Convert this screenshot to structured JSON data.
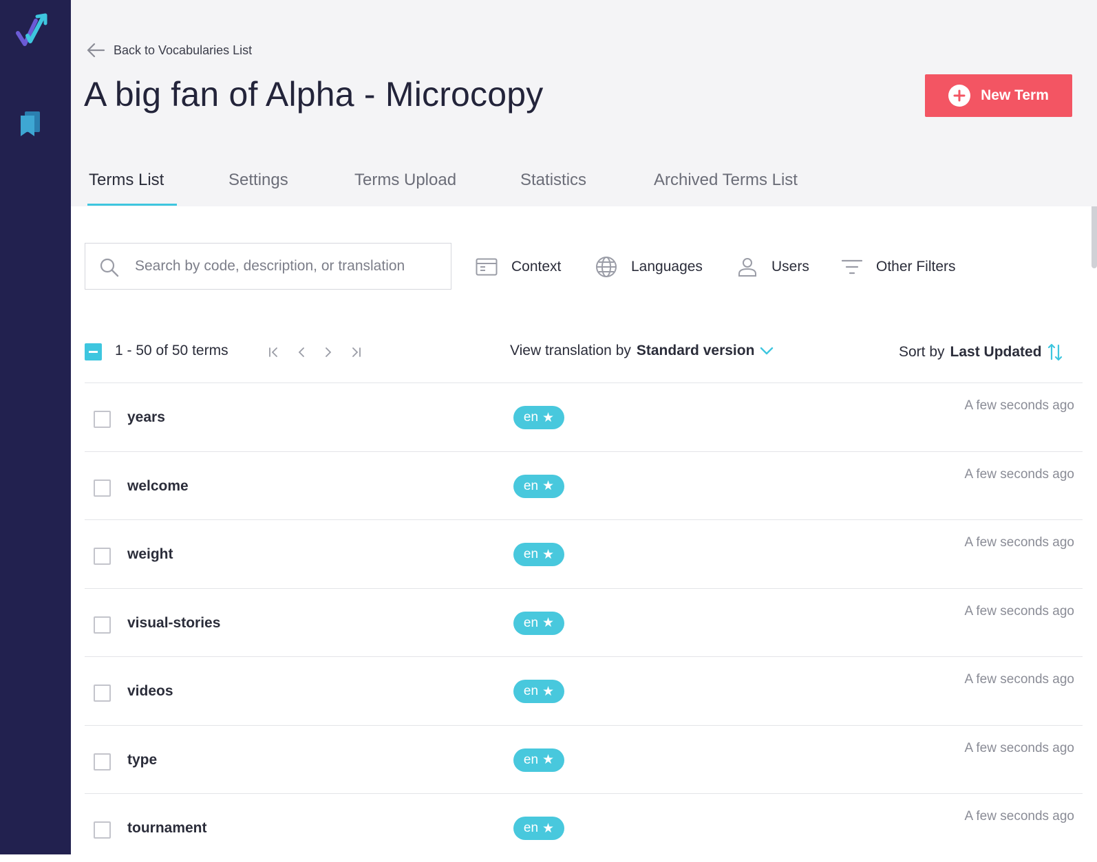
{
  "app": {
    "accent": "#3ec6df",
    "sidebar_bg": "#22214f",
    "primary_btn": "#f35563"
  },
  "sidebar": {
    "logo_icon": "checkmark-arrow-logo",
    "items": [
      {
        "icon": "bookmark-icon",
        "name": "vocabularies"
      }
    ]
  },
  "header": {
    "back_label": "Back to Vocabularies List",
    "title": "A big fan of Alpha - Microcopy",
    "new_term_label": "New Term"
  },
  "tabs": [
    {
      "label": "Terms List",
      "active": true
    },
    {
      "label": "Settings",
      "active": false
    },
    {
      "label": "Terms Upload",
      "active": false
    },
    {
      "label": "Statistics",
      "active": false
    },
    {
      "label": "Archived Terms List",
      "active": false
    }
  ],
  "search": {
    "placeholder": "Search by code, description, or translation",
    "value": ""
  },
  "filters": [
    {
      "label": "Context",
      "icon": "window-icon"
    },
    {
      "label": "Languages",
      "icon": "globe-icon"
    },
    {
      "label": "Users",
      "icon": "user-icon"
    },
    {
      "label": "Other Filters",
      "icon": "filter-icon"
    }
  ],
  "toolbar": {
    "count": "1 - 50 of 50 terms",
    "view_prefix": "View translation by",
    "view_value": "Standard version",
    "sort_prefix": "Sort by",
    "sort_value": "Last Updated"
  },
  "terms": [
    {
      "name": "years",
      "lang": "en",
      "updated": "A few seconds ago"
    },
    {
      "name": "welcome",
      "lang": "en",
      "updated": "A few seconds ago"
    },
    {
      "name": "weight",
      "lang": "en",
      "updated": "A few seconds ago"
    },
    {
      "name": "visual-stories",
      "lang": "en",
      "updated": "A few seconds ago"
    },
    {
      "name": "videos",
      "lang": "en",
      "updated": "A few seconds ago"
    },
    {
      "name": "type",
      "lang": "en",
      "updated": "A few seconds ago"
    },
    {
      "name": "tournament",
      "lang": "en",
      "updated": "A few seconds ago"
    }
  ]
}
